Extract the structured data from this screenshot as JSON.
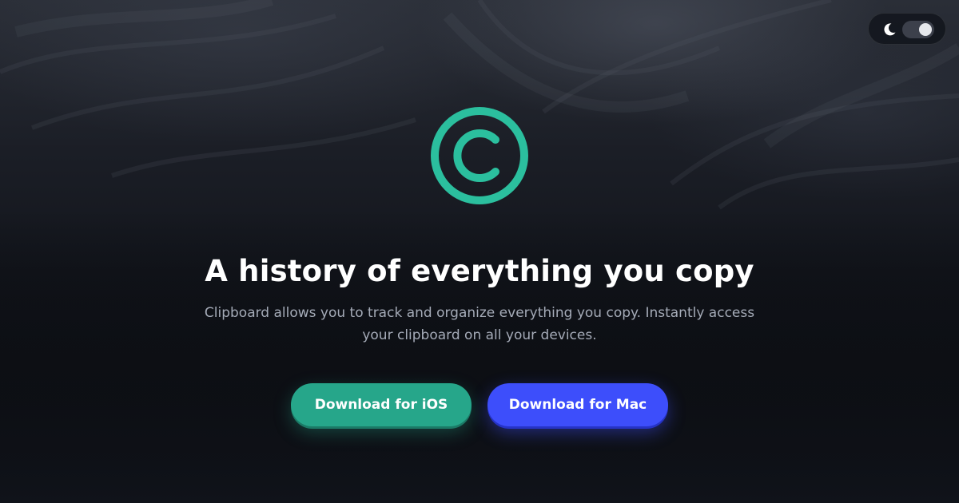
{
  "header": {
    "theme_toggle": {
      "icon": "moon-icon",
      "state": "dark"
    }
  },
  "hero": {
    "logo_icon": "copyright-circle-icon",
    "title": "A history of everything you copy",
    "subtitle_line1": "Clipboard allows you to track and organize everything you copy. Instantly access",
    "subtitle_line2": "your clipboard on all your devices."
  },
  "actions": {
    "ios_label": "Download for iOS",
    "mac_label": "Download for Mac"
  },
  "colors": {
    "background": "#11141b",
    "accent_teal": "#26a68a",
    "logo_teal": "#2bbf9e",
    "accent_blue": "#3d4efb",
    "subtitle_gray": "#a5abb8"
  }
}
